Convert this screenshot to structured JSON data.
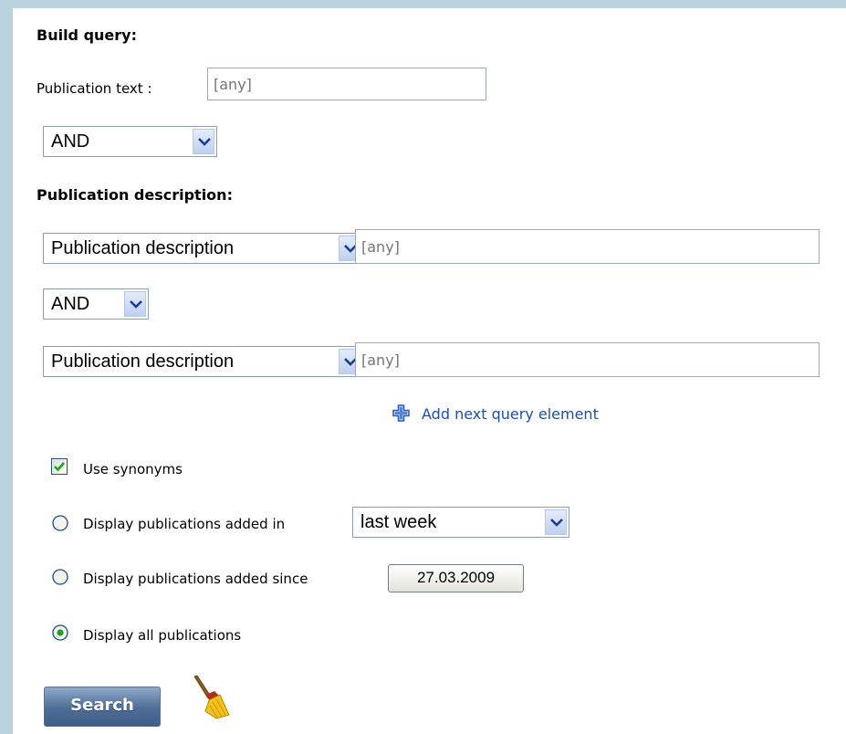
{
  "build_query": {
    "heading": "Build query:",
    "publication_text_label": "Publication text :",
    "publication_text_placeholder": "[any]",
    "operator_value": "AND"
  },
  "publication_description": {
    "heading": "Publication description:",
    "rows": [
      {
        "field_value": "Publication description",
        "input_placeholder": "[any]"
      },
      {
        "field_value": "Publication description",
        "input_placeholder": "[any]"
      }
    ],
    "operator_value": "AND",
    "add_label": "Add next query element"
  },
  "options": {
    "use_synonyms_label": "Use synonyms",
    "use_synonyms_checked": true,
    "added_in_label": "Display publications added in",
    "added_in_value": "last week",
    "added_since_label": "Display publications added since",
    "added_since_date": "27.03.2009",
    "all_label": "Display all publications",
    "selected_option": "all"
  },
  "actions": {
    "search_label": "Search",
    "clear_icon": "broom-icon"
  }
}
